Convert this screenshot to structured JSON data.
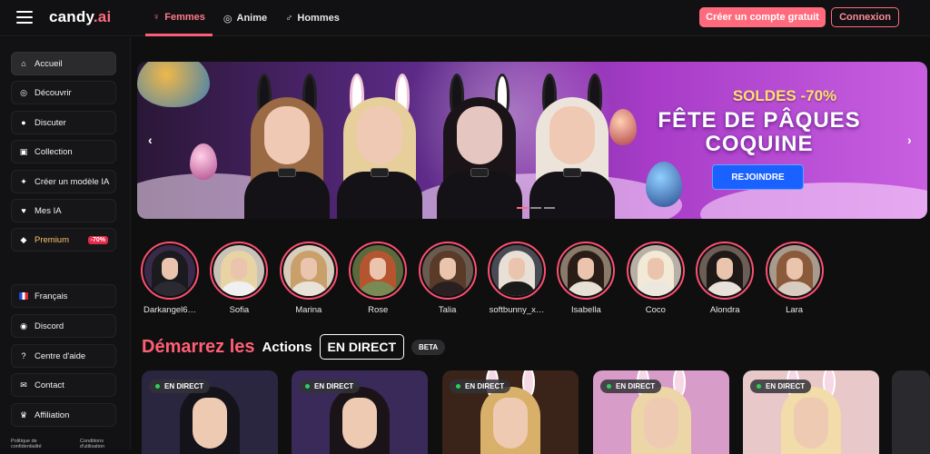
{
  "header": {
    "logo_main": "candy",
    "logo_dot": ".ai",
    "nav": [
      {
        "label": "Femmes",
        "icon": "female-icon",
        "glyph": "♀",
        "active": true
      },
      {
        "label": "Anime",
        "icon": "anime-icon",
        "glyph": "◎",
        "active": false
      },
      {
        "label": "Hommes",
        "icon": "male-icon",
        "glyph": "♂",
        "active": false
      }
    ],
    "signup_label": "Créer un compte gratuit",
    "login_label": "Connexion"
  },
  "sidebar": {
    "items": [
      {
        "label": "Accueil",
        "icon": "home-icon",
        "glyph": "⌂"
      },
      {
        "label": "Découvrir",
        "icon": "compass-icon",
        "glyph": "◎"
      },
      {
        "label": "Discuter",
        "icon": "chat-icon",
        "glyph": "●"
      },
      {
        "label": "Collection",
        "icon": "collection-icon",
        "glyph": "▣"
      },
      {
        "label": "Créer un modèle IA",
        "icon": "magic-wand-icon",
        "glyph": "✦"
      },
      {
        "label": "Mes IA",
        "icon": "heart-icon",
        "glyph": "♥"
      },
      {
        "label": "Premium",
        "icon": "diamond-icon",
        "glyph": "◆",
        "badge": "-70%"
      }
    ],
    "bottom_items": [
      {
        "label": "Français",
        "icon": "flag-fr-icon"
      },
      {
        "label": "Discord",
        "icon": "discord-icon",
        "glyph": "◉"
      },
      {
        "label": "Centre d'aide",
        "icon": "help-icon",
        "glyph": "?"
      },
      {
        "label": "Contact",
        "icon": "mail-icon",
        "glyph": "✉"
      },
      {
        "label": "Affiliation",
        "icon": "trophy-icon",
        "glyph": "♛"
      }
    ],
    "footer": [
      "Politique de confidentialité",
      "Conditions d'utilisation"
    ]
  },
  "banner": {
    "sale": "SOLDES -70%",
    "title_line1": "FÊTE DE PÂQUES",
    "title_line2": "COQUINE",
    "cta": "REJOINDRE"
  },
  "characters": [
    {
      "name": "Darkangel6…",
      "hair": "#1b1a1f",
      "body": "#2a2a30",
      "bg": "#3a2a4a"
    },
    {
      "name": "Sofia",
      "hair": "#e8d3a4",
      "body": "#f0f0f0",
      "bg": "#c9c2b8"
    },
    {
      "name": "Marina",
      "hair": "#c9a06a",
      "body": "#e8e2d8",
      "bg": "#d8cdbd"
    },
    {
      "name": "Rose",
      "hair": "#b5552f",
      "body": "#7a8a55",
      "bg": "#5a6a3d"
    },
    {
      "name": "Talia",
      "hair": "#5a3a28",
      "body": "#2a2022",
      "bg": "#6a5a50"
    },
    {
      "name": "softbunny_x…",
      "hair": "#e8e0d6",
      "body": "#1a1a1a",
      "bg": "#4a4a55"
    },
    {
      "name": "Isabella",
      "hair": "#2a1d18",
      "body": "#e6e0d5",
      "bg": "#8a7a6a"
    },
    {
      "name": "Coco",
      "hair": "#f2ead6",
      "body": "#ece8e0",
      "bg": "#b8b0a6"
    },
    {
      "name": "Alondra",
      "hair": "#1e1816",
      "body": "#e8e2da",
      "bg": "#6a5e56"
    },
    {
      "name": "Lara",
      "hair": "#8a5a3a",
      "body": "#d8ccc0",
      "bg": "#a89a8c"
    }
  ],
  "live": {
    "title_pink": "Démarrez les",
    "title_white": "Actions",
    "title_box": "EN DIRECT",
    "beta": "BETA",
    "cards": [
      {
        "tag": "EN DIRECT",
        "bg": "#2a2640",
        "hair": "#15131a",
        "ears": false
      },
      {
        "tag": "EN DIRECT",
        "bg": "#3a2a5a",
        "hair": "#1a1418",
        "ears": false
      },
      {
        "tag": "EN DIRECT",
        "bg": "#3a241a",
        "hair": "#d8b06a",
        "ears": true
      },
      {
        "tag": "EN DIRECT",
        "bg": "#d89cc8",
        "hair": "#ecd6a8",
        "ears": true
      },
      {
        "tag": "EN DIRECT",
        "bg": "#e8c8c8",
        "hair": "#f2dcaa",
        "ears": true
      }
    ]
  }
}
